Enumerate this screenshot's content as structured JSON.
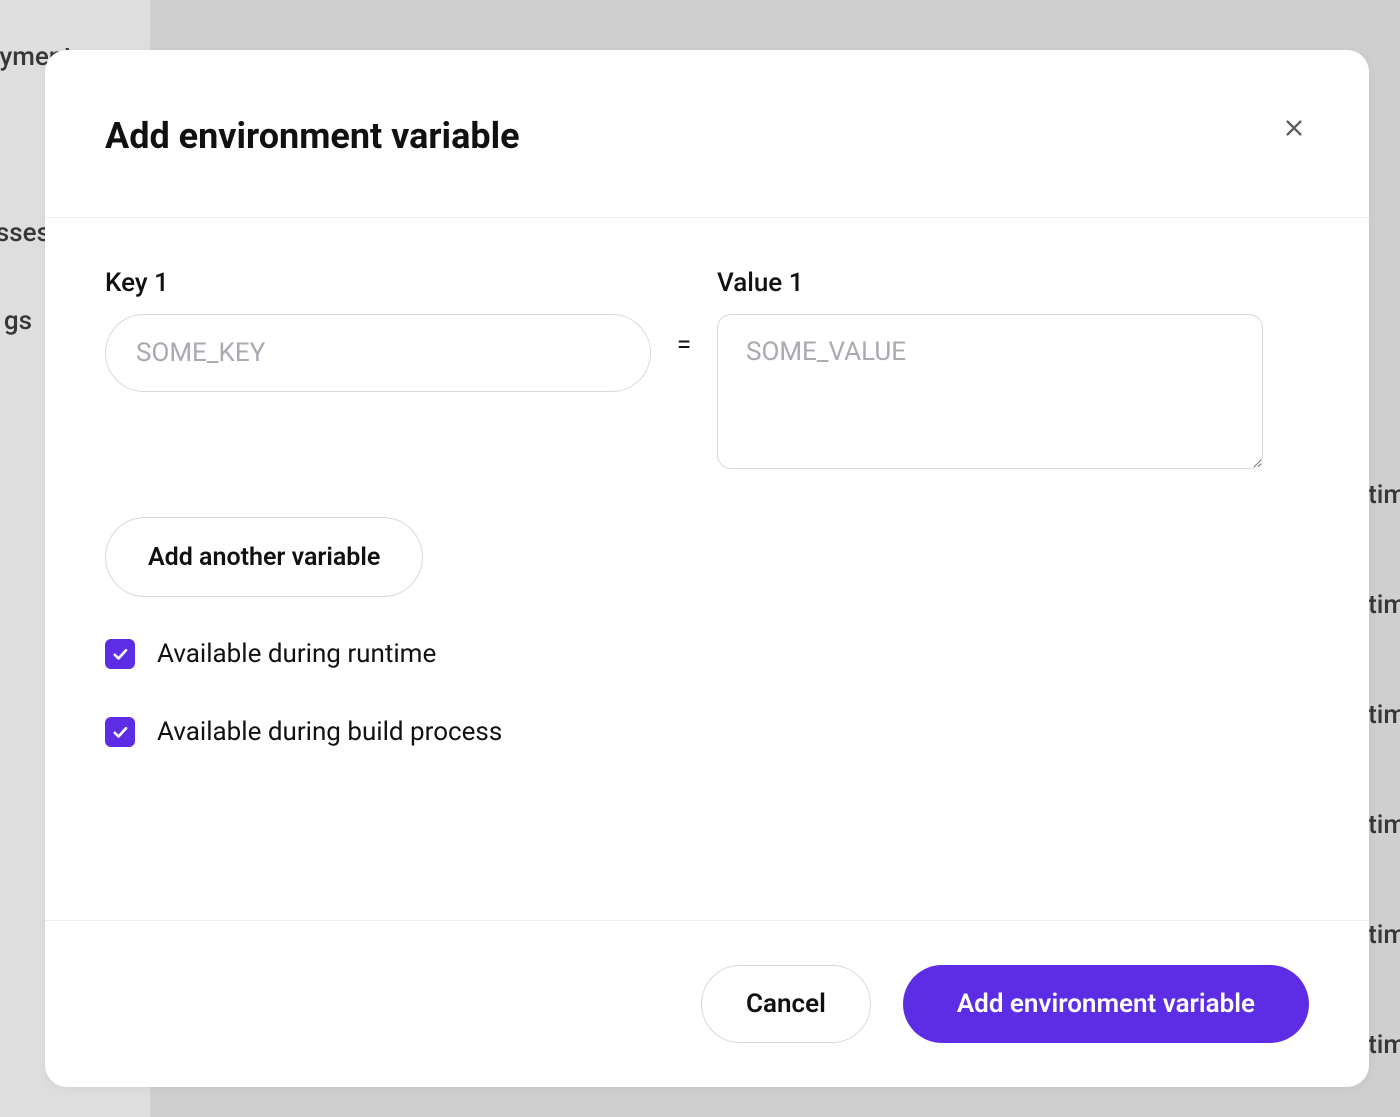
{
  "background": {
    "sidebar_fragments": [
      "yment",
      "sses",
      "gs"
    ],
    "main_fragments": [
      "ntime",
      "ntime",
      "ntime",
      "ntime",
      "ntime",
      "ntime"
    ]
  },
  "modal": {
    "title": "Add environment variable",
    "equals_symbol": "=",
    "fields": {
      "key_label": "Key 1",
      "key_placeholder": "SOME_KEY",
      "value_label": "Value 1",
      "value_placeholder": "SOME_VALUE"
    },
    "add_another_label": "Add another variable",
    "checkboxes": {
      "runtime": {
        "label": "Available during runtime",
        "checked": true
      },
      "build": {
        "label": "Available during build process",
        "checked": true
      }
    },
    "footer": {
      "cancel": "Cancel",
      "submit": "Add environment variable"
    }
  }
}
